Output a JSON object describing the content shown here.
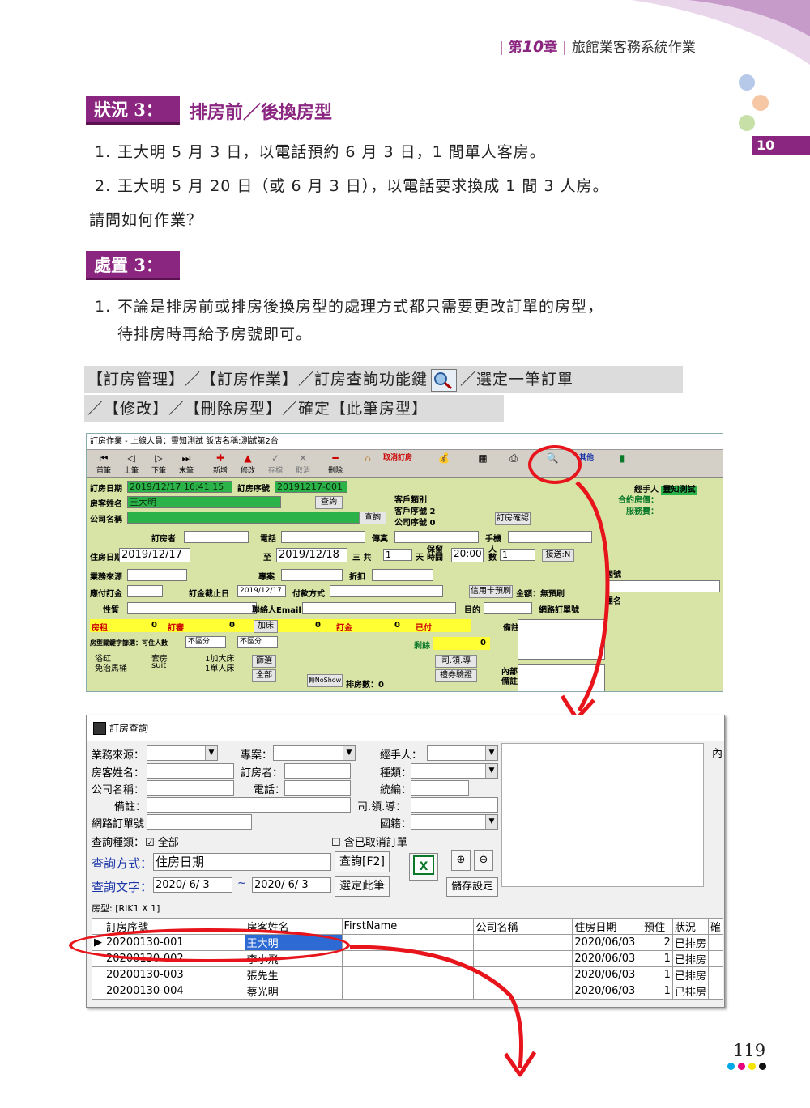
{
  "header": {
    "chapter_prefix": "第",
    "chapter_number": "10",
    "chapter_suffix": "章",
    "chapter_title": "旅館業客務系統作業",
    "tab_number": "10",
    "accent_color": "#8a2580"
  },
  "situation": {
    "label": "狀況 3：",
    "title": "排房前／後換房型",
    "items": [
      {
        "num": "1.",
        "text": "王大明 5 月 3 日，以電話預約 6 月 3 日，1 間單人客房。"
      },
      {
        "num": "2.",
        "text": "王大明 5 月 20 日（或 6 月 3 日），以電話要求換成 1 間 3 人房。"
      }
    ],
    "question": "請問如何作業？"
  },
  "handling": {
    "label": "處置 3：",
    "items": [
      {
        "num": "1.",
        "line1": "不論是排房前或排房後換房型的處理方式都只需要更改訂單的房型，",
        "line2": "待排房時再給予房號即可。"
      }
    ]
  },
  "path": {
    "line1_a": "【訂房管理】／【訂房作業】／訂房查詢功能鍵",
    "line1_b": "／選定一筆訂單",
    "line2": "／【修改】／【刪除房型】／確定【此筆房型】"
  },
  "screenshot1": {
    "title": "訂房作業 - 上線人員：靈知測試 飯店名稱:測試第2台",
    "toolbar": [
      "首筆",
      "上筆",
      "下筆",
      "末筆",
      "新增",
      "修改",
      "存檔",
      "取消",
      "刪除",
      "取消訂房",
      "其他"
    ],
    "booking_date_label": "訂房日期",
    "booking_date": "2019/12/17 16:41:15",
    "booking_no_label": "訂房序號",
    "booking_no": "20191217-001",
    "guest_label": "房客姓名",
    "guest_name": "王大明",
    "company_label": "公司名稱",
    "query_btn": "查詢",
    "customer_type_label": "客戶類別",
    "customer_no_label": "客戶序號",
    "customer_no": "2",
    "company_no_label": "公司序號",
    "company_no": "0",
    "confirm_btn": "訂房確認",
    "agent_label": "經手人",
    "agent_name": "靈知測試",
    "contract_price": "合約房價：",
    "service_fee": "服務費：",
    "booker_label": "訂房者",
    "phone_label": "電話",
    "fax_label": "傳真",
    "mobile_label": "手機",
    "checkin_label": "住房日期",
    "checkin": "2019/12/17",
    "to_label": "至",
    "checkout": "2019/12/18",
    "total_label": "三 共",
    "nights": "1",
    "days_label": "天",
    "hold_label": "保留時間",
    "hold_time": "20:00",
    "persons_label": "人數",
    "persons": "1",
    "pickup_btn": "接送:N",
    "source_label": "業務來源",
    "project_label": "專案",
    "discount_label": "折扣",
    "country_label": "國號",
    "group_label": "團名",
    "deposit_label": "應付訂金",
    "deadline_label": "訂金截止日",
    "deadline": "2019/12/17",
    "payment_label": "付款方式",
    "credit_btn": "信用卡預刷",
    "amount_label": "金額：無預刷",
    "nature_label": "性質",
    "contact_email_label": "聯絡人Email",
    "purpose_label": "目的",
    "web_order_label": "網路訂單號",
    "room_label": "房租",
    "room_val": "0",
    "deposit_val_label": "訂審",
    "deposit_val": "0",
    "add_bed": "加床",
    "deposit2_val": "0",
    "deposit2_label": "訂金",
    "paid_val": "0",
    "paid_label": "已付",
    "balance_label": "剩餘",
    "balance_val": "0",
    "remark_label": "備註",
    "remark2_label": "內部備註",
    "room_types": [
      "浴缸",
      "免治馬桶",
      "套房",
      "suit",
      "1加大床",
      "1單人床"
    ],
    "filter_btn": "篩選",
    "all_btn": "全部",
    "noshow_btn": "轉NoShow",
    "assigned_label": "排房數：0",
    "tour_btn": "司.領.導",
    "gift_btn": "禮券驗證",
    "room_query_label": "房型關鍵字篩選：可住人數",
    "no_distinct": "不區分"
  },
  "screenshot2": {
    "title": "訂房查詢",
    "source_label": "業務來源：",
    "project_label": "專案：",
    "agent_label": "經手人：",
    "remark_label": "備註",
    "inner_label": "內",
    "guest_label": "房客姓名：",
    "booker_label": "訂房者：",
    "type_label": "種類：",
    "company_label": "公司名稱：",
    "phone_label": "電話：",
    "tax_label": "統編：",
    "note_label": "備註：",
    "tour_label": "司.領.導：",
    "web_label": "網路訂單號",
    "country_label": "國籍：",
    "query_type_label": "查詢種類：",
    "all_label": "全部",
    "cancel_label": "含已取消訂單",
    "query_method_label": "查詢方式：",
    "query_method_value": "住房日期",
    "query_btn": "查詢[F2]",
    "query_text_label": "查詢文字：",
    "date_from": "2020/ 6/ 3",
    "tilde": "~",
    "date_to": "2020/ 6/ 3",
    "select_btn": "選定此筆",
    "save_btn": "儲存設定",
    "room_type_line": "房型: [RIK1 X 1]",
    "columns": [
      "訂房序號",
      "房客姓名",
      "FirstName",
      "公司名稱",
      "住房日期",
      "預住",
      "狀況",
      "確"
    ],
    "rows": [
      {
        "no": "20200130-001",
        "name": "王大明",
        "first": "",
        "company": "",
        "date": "2020/06/03",
        "count": "2",
        "status": "已排房"
      },
      {
        "no": "20200130-002",
        "name": "李小飛",
        "first": "",
        "company": "",
        "date": "2020/06/03",
        "count": "1",
        "status": "已排房"
      },
      {
        "no": "20200130-003",
        "name": "張先生",
        "first": "",
        "company": "",
        "date": "2020/06/03",
        "count": "1",
        "status": "已排房"
      },
      {
        "no": "20200130-004",
        "name": "蔡光明",
        "first": "",
        "company": "",
        "date": "2020/06/03",
        "count": "1",
        "status": "已排房"
      }
    ]
  },
  "page_number": "119"
}
